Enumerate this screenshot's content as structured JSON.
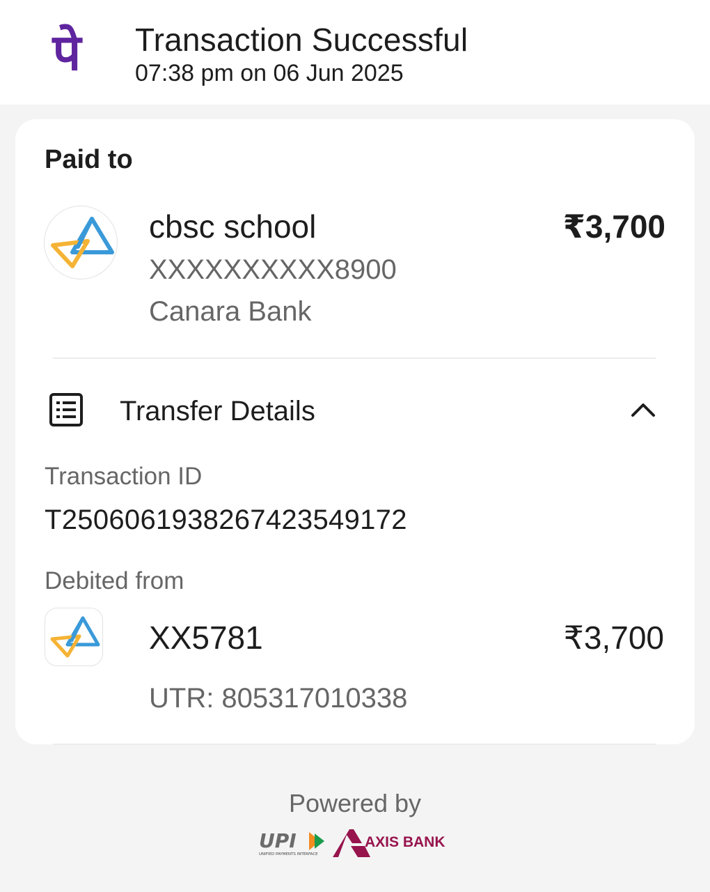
{
  "header": {
    "title": "Transaction Successful",
    "subtitle": "07:38 pm on 06 Jun 2025",
    "logo_glyph": "पे",
    "brand_color": "#5f259f"
  },
  "paid_to": {
    "label": "Paid to",
    "name": "cbsc school",
    "account": "XXXXXXXXXX8900",
    "bank": "Canara Bank",
    "amount": "₹3,700",
    "icon": "canara-bank-logo-icon"
  },
  "transfer_details": {
    "title": "Transfer Details",
    "icon": "receipt-list-icon",
    "toggle_icon": "chevron-up-icon",
    "transaction_id_label": "Transaction ID",
    "transaction_id": "T2506061938267423549172",
    "debited_from_label": "Debited from",
    "debit_account": "XX5781",
    "debit_amount": "₹3,700",
    "utr": "UTR: 805317010338",
    "debit_icon": "canara-bank-logo-icon"
  },
  "footer": {
    "powered_by": "Powered by",
    "upi_text": "UPI",
    "upi_tagline": "UNIFIED PAYMENTS INTERFACE",
    "axis_text": "AXIS BANK",
    "axis_color": "#97144d"
  }
}
